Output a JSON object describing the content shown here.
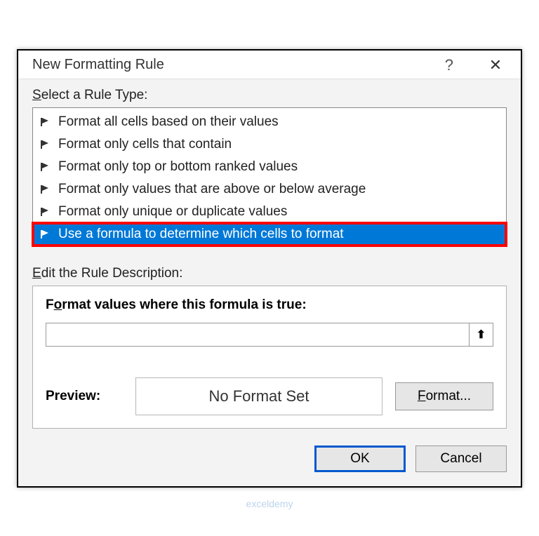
{
  "dialog": {
    "title": "New Formatting Rule",
    "help": "?",
    "close": "✕"
  },
  "ruleTypeLabel": {
    "pre": "S",
    "post": "elect a Rule Type:"
  },
  "ruleItems": [
    {
      "text": "Format all cells based on their values",
      "selected": false
    },
    {
      "text": "Format only cells that contain",
      "selected": false
    },
    {
      "text": "Format only top or bottom ranked values",
      "selected": false
    },
    {
      "text": "Format only values that are above or below average",
      "selected": false
    },
    {
      "text": "Format only unique or duplicate values",
      "selected": false
    },
    {
      "text": "Use a formula to determine which cells to format",
      "selected": true
    }
  ],
  "editLabel": {
    "pre": "E",
    "post": "dit the Rule Description:"
  },
  "formulaLabel": {
    "pre": "F",
    "mid": "o",
    "post": "rmat values where this formula is true:"
  },
  "formulaValue": "",
  "pickerIcon": "⬆",
  "previewLabel": "Preview:",
  "previewText": "No Format Set",
  "formatBtn": {
    "pre": "F",
    "post": "ormat..."
  },
  "okBtn": "OK",
  "cancelBtn": "Cancel",
  "watermark": "exceldemy"
}
